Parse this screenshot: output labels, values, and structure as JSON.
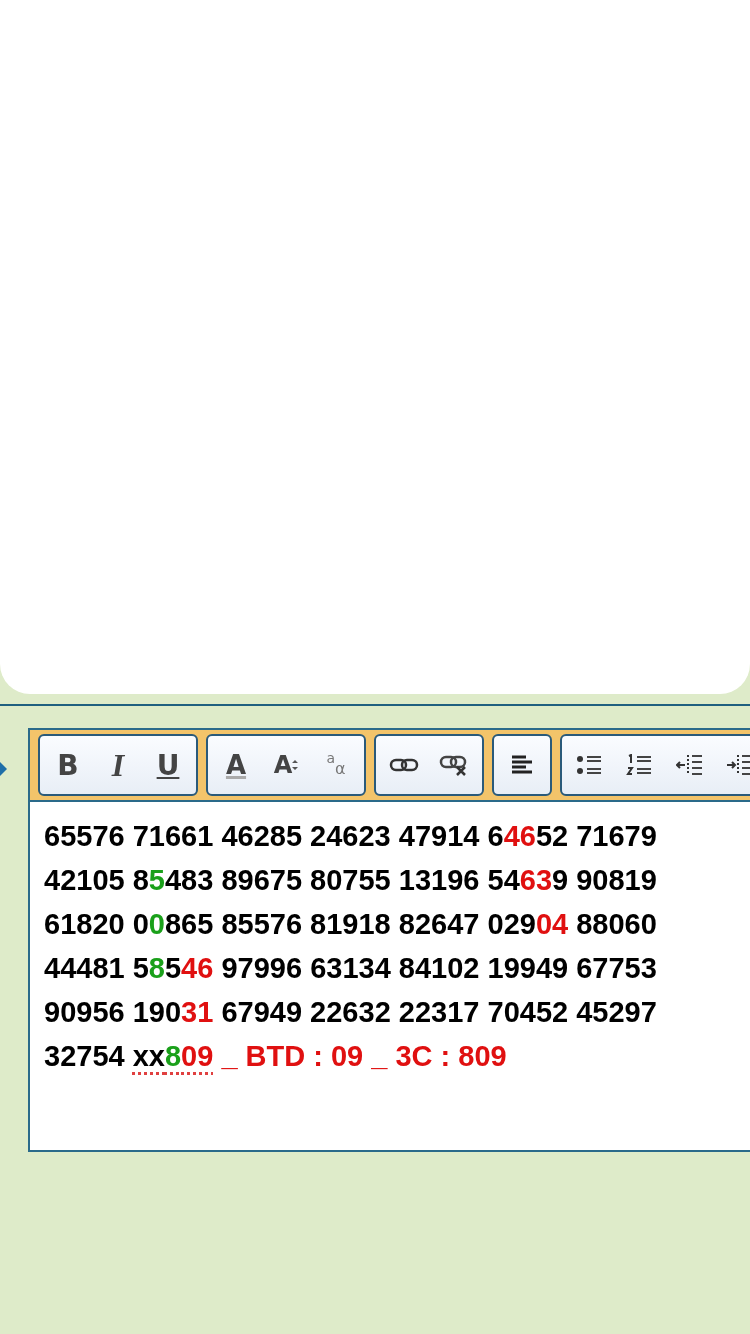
{
  "toolbar": {
    "groups": [
      {
        "buttons": [
          {
            "kind": "bold",
            "label": "B"
          },
          {
            "kind": "italic",
            "label": "I"
          },
          {
            "kind": "underline",
            "label": "U"
          }
        ]
      },
      {
        "buttons": [
          {
            "kind": "text-color",
            "label": "A"
          },
          {
            "kind": "font-size",
            "label": "A"
          },
          {
            "kind": "subscript",
            "label": "a",
            "sub_label": "α"
          }
        ]
      },
      {
        "buttons": [
          {
            "kind": "link"
          },
          {
            "kind": "unlink"
          }
        ]
      },
      {
        "buttons": [
          {
            "kind": "align-left"
          }
        ]
      },
      {
        "buttons": [
          {
            "kind": "bullet-list"
          },
          {
            "kind": "numbered-list"
          },
          {
            "kind": "outdent"
          },
          {
            "kind": "indent"
          }
        ]
      }
    ]
  },
  "editor": {
    "lines": [
      {
        "segments": [
          {
            "text": "65576 71661 46285 24623 47914 6",
            "color": "#000000"
          },
          {
            "text": "46",
            "color": "#e01010"
          },
          {
            "text": "52 71679",
            "color": "#000000"
          }
        ]
      },
      {
        "segments": [
          {
            "text": "42105 8",
            "color": "#000000"
          },
          {
            "text": "5",
            "color": "#1aa01a"
          },
          {
            "text": "483 89675 80755 13196 54",
            "color": "#000000"
          },
          {
            "text": "63",
            "color": "#e01010"
          },
          {
            "text": "9 90819",
            "color": "#000000"
          }
        ]
      },
      {
        "segments": [
          {
            "text": "61820 0",
            "color": "#000000"
          },
          {
            "text": "0",
            "color": "#1aa01a"
          },
          {
            "text": "865 85576 81918 82647 029",
            "color": "#000000"
          },
          {
            "text": "04",
            "color": "#e01010"
          },
          {
            "text": " 88060",
            "color": "#000000"
          }
        ]
      },
      {
        "segments": [
          {
            "text": "44481 5",
            "color": "#000000"
          },
          {
            "text": "8",
            "color": "#1aa01a"
          },
          {
            "text": "5",
            "color": "#000000"
          },
          {
            "text": "46",
            "color": "#e01010"
          },
          {
            "text": " 97996 63134 84102 19949 67753",
            "color": "#000000"
          }
        ]
      },
      {
        "segments": [
          {
            "text": "90956 190",
            "color": "#000000"
          },
          {
            "text": "31",
            "color": "#e01010"
          },
          {
            "text": " 67949 22632 22317 70452 45297",
            "color": "#000000"
          }
        ]
      },
      {
        "segments": [
          {
            "text": "32754 ",
            "color": "#000000"
          },
          {
            "text": "xx",
            "color": "#000000",
            "misspelled": true
          },
          {
            "text": "8",
            "color": "#1aa01a",
            "misspelled": true
          },
          {
            "text": "09",
            "color": "#e01010",
            "misspelled": true
          },
          {
            "text": " _ BTD : 09 _ 3C : 809",
            "color": "#e01010"
          }
        ]
      }
    ]
  }
}
